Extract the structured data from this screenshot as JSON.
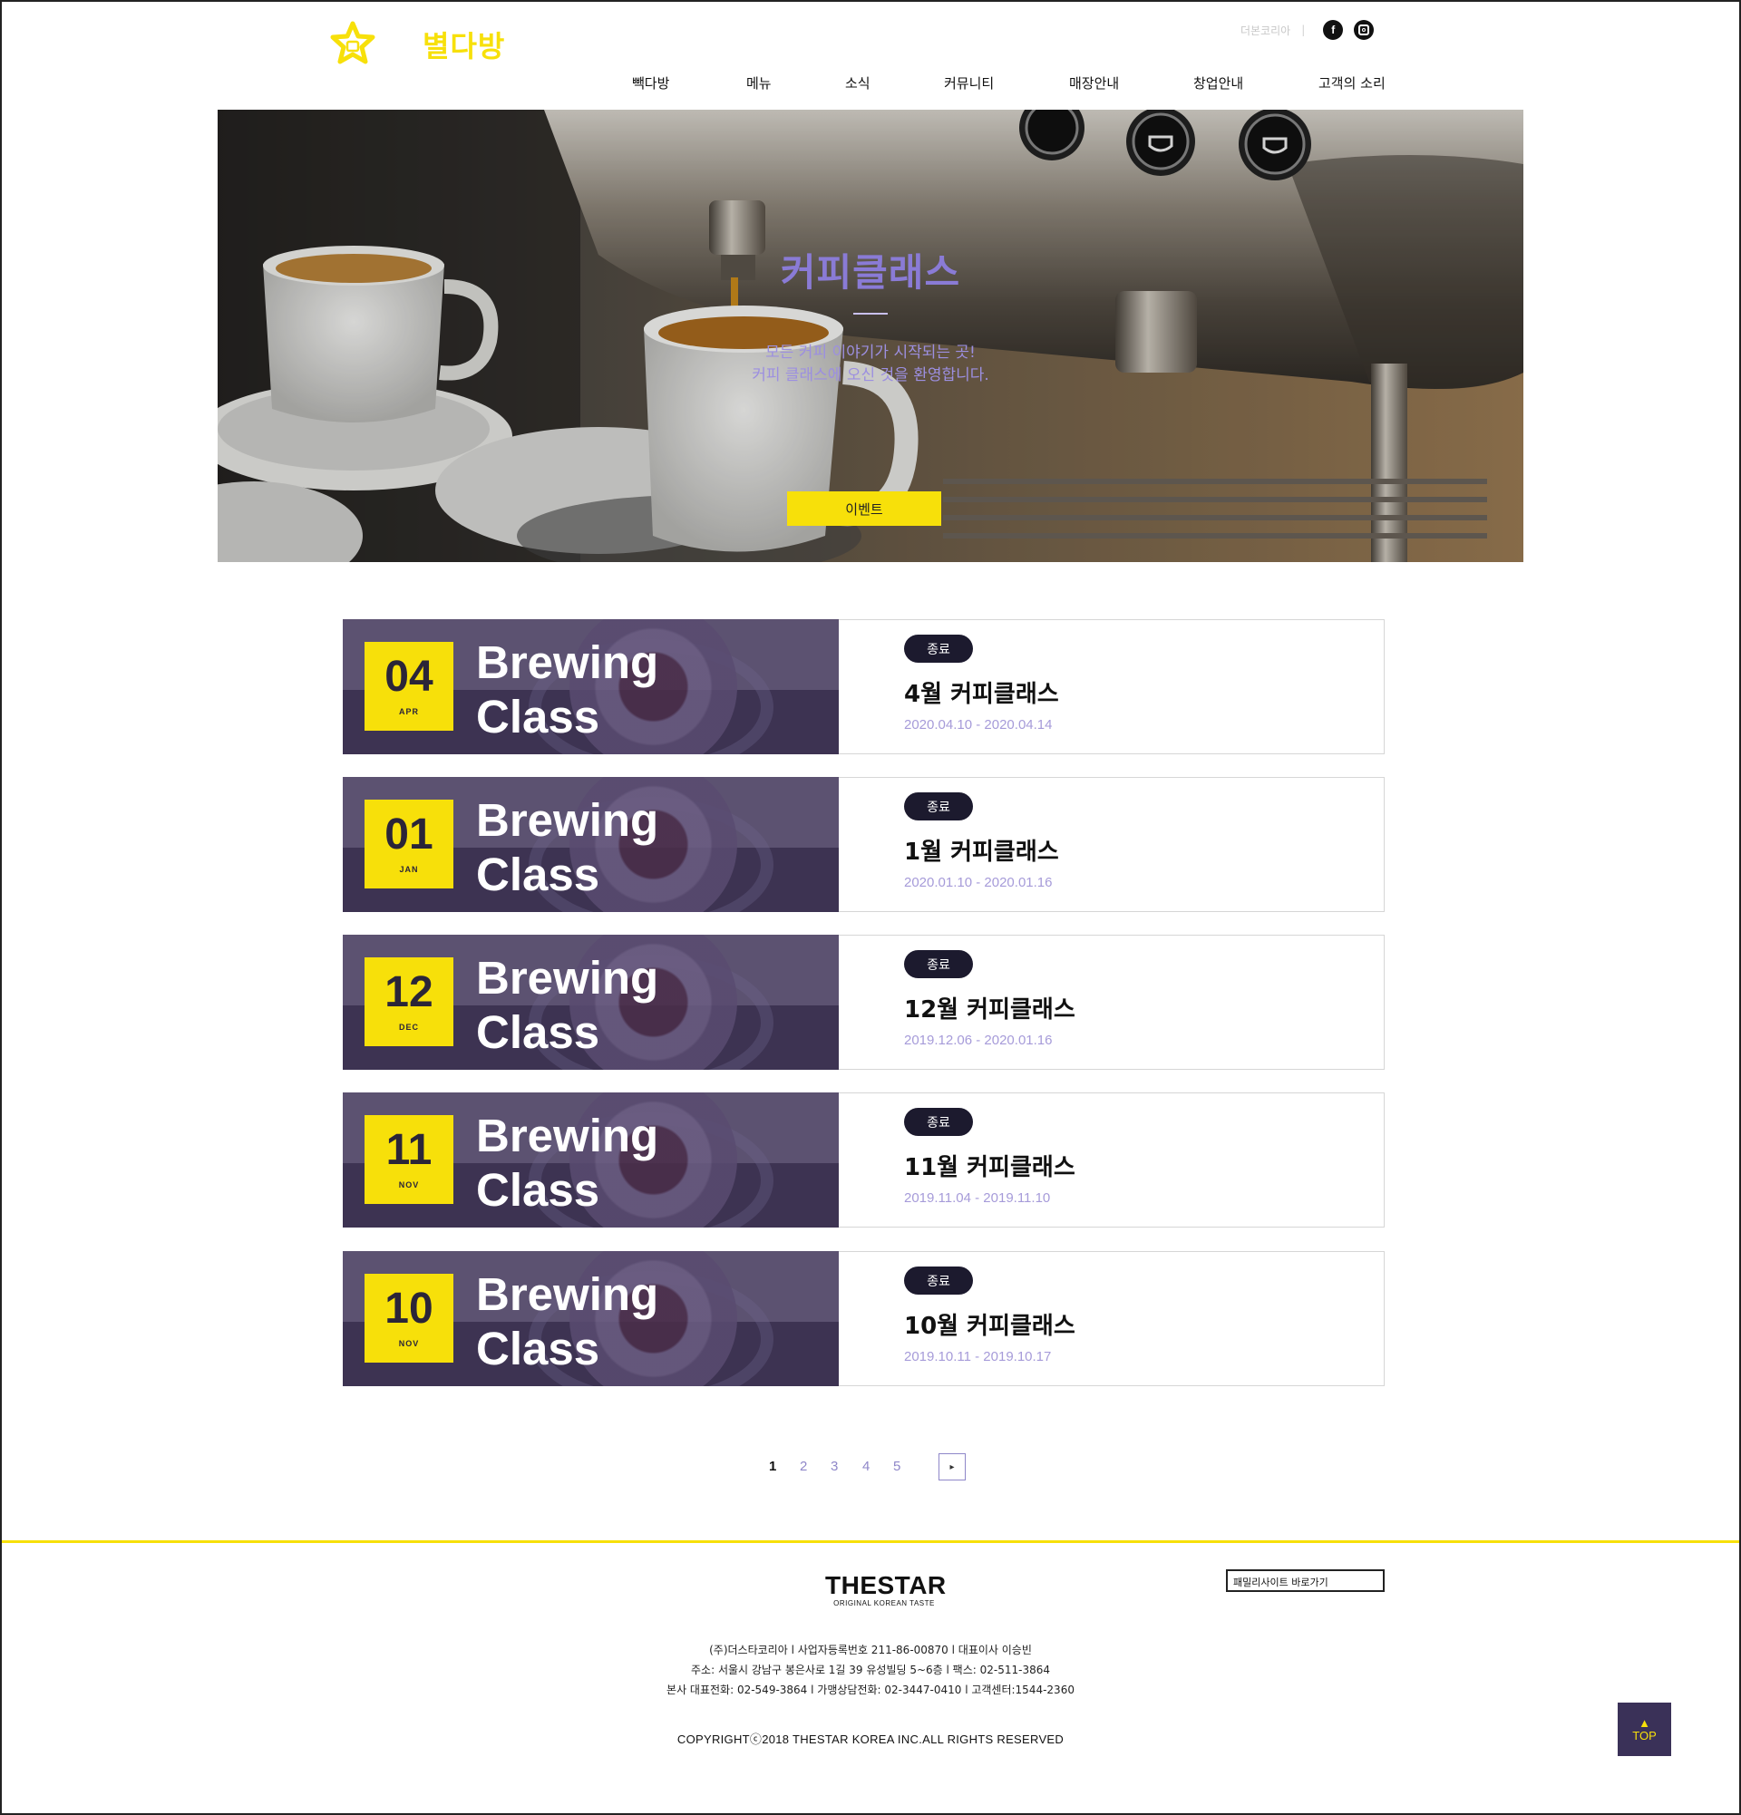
{
  "header": {
    "logo_text": "별다방",
    "top_link": "더본코리아",
    "top_sep": "|",
    "social": [
      {
        "icon": "facebook-icon",
        "glyph": "f"
      },
      {
        "icon": "instagram-icon",
        "glyph": ""
      }
    ],
    "nav": [
      "빽다방",
      "메뉴",
      "소식",
      "커뮤니티",
      "매장안내",
      "창업안내",
      "고객의 소리"
    ]
  },
  "hero": {
    "title": "커피클래스",
    "subtitle_line1": "모든 커피 이야기가 시작되는 곳!",
    "subtitle_line2": "커피 클래스에 오신 것을 환영합니다.",
    "button_label": "이벤트"
  },
  "events": [
    {
      "day": "04",
      "month": "APR",
      "thumb_line1": "Brewing",
      "thumb_line2": "Class",
      "status": "종료",
      "title": "4월 커피클래스",
      "dates": "2020.04.10 - 2020.04.14"
    },
    {
      "day": "01",
      "month": "JAN",
      "thumb_line1": "Brewing",
      "thumb_line2": "Class",
      "status": "종료",
      "title": "1월 커피클래스",
      "dates": "2020.01.10 - 2020.01.16"
    },
    {
      "day": "12",
      "month": "DEC",
      "thumb_line1": "Brewing",
      "thumb_line2": "Class",
      "status": "종료",
      "title": "12월 커피클래스",
      "dates": "2019.12.06 - 2020.01.16"
    },
    {
      "day": "11",
      "month": "NOV",
      "thumb_line1": "Brewing",
      "thumb_line2": "Class",
      "status": "종료",
      "title": "11월 커피클래스",
      "dates": "2019.11.04 - 2019.11.10"
    },
    {
      "day": "10",
      "month": "NOV",
      "thumb_line1": "Brewing",
      "thumb_line2": "Class",
      "status": "종료",
      "title": "10월 커피클래스",
      "dates": "2019.10.11 - 2019.10.17"
    }
  ],
  "pagination": {
    "pages": [
      "1",
      "2",
      "3",
      "4",
      "5"
    ],
    "current": "1",
    "next_glyph": "▸"
  },
  "footer": {
    "brand_name": "THESTAR",
    "brand_tagline": "ORIGINAL KOREAN TASTE",
    "family_site": "패밀리사이트 바로가기",
    "info_line1": "(주)더스타코리아 l     사업자등록번호 211-86-00870     l     대표이사 이승빈",
    "info_line2": "주소: 서울시 강남구 봉은사로 1길 39 유성빌딩 5~6층     l     팩스: 02-511-3864",
    "info_line3": "본사 대표전화: 02-549-3864     l     가맹상담전화: 02-3447-0410     l     고객센터:1544-2360",
    "copyright": "COPYRIGHTⓒ2018 THESTAR KOREA INC.ALL RIGHTS RESERVED"
  },
  "top_button": {
    "arrow": "▲",
    "label": "TOP"
  },
  "colors": {
    "accent_yellow": "#f7e00a",
    "purple_dark": "#3a3158",
    "purple_text": "#a69bd9",
    "badge_bg": "#1c1a2e"
  }
}
